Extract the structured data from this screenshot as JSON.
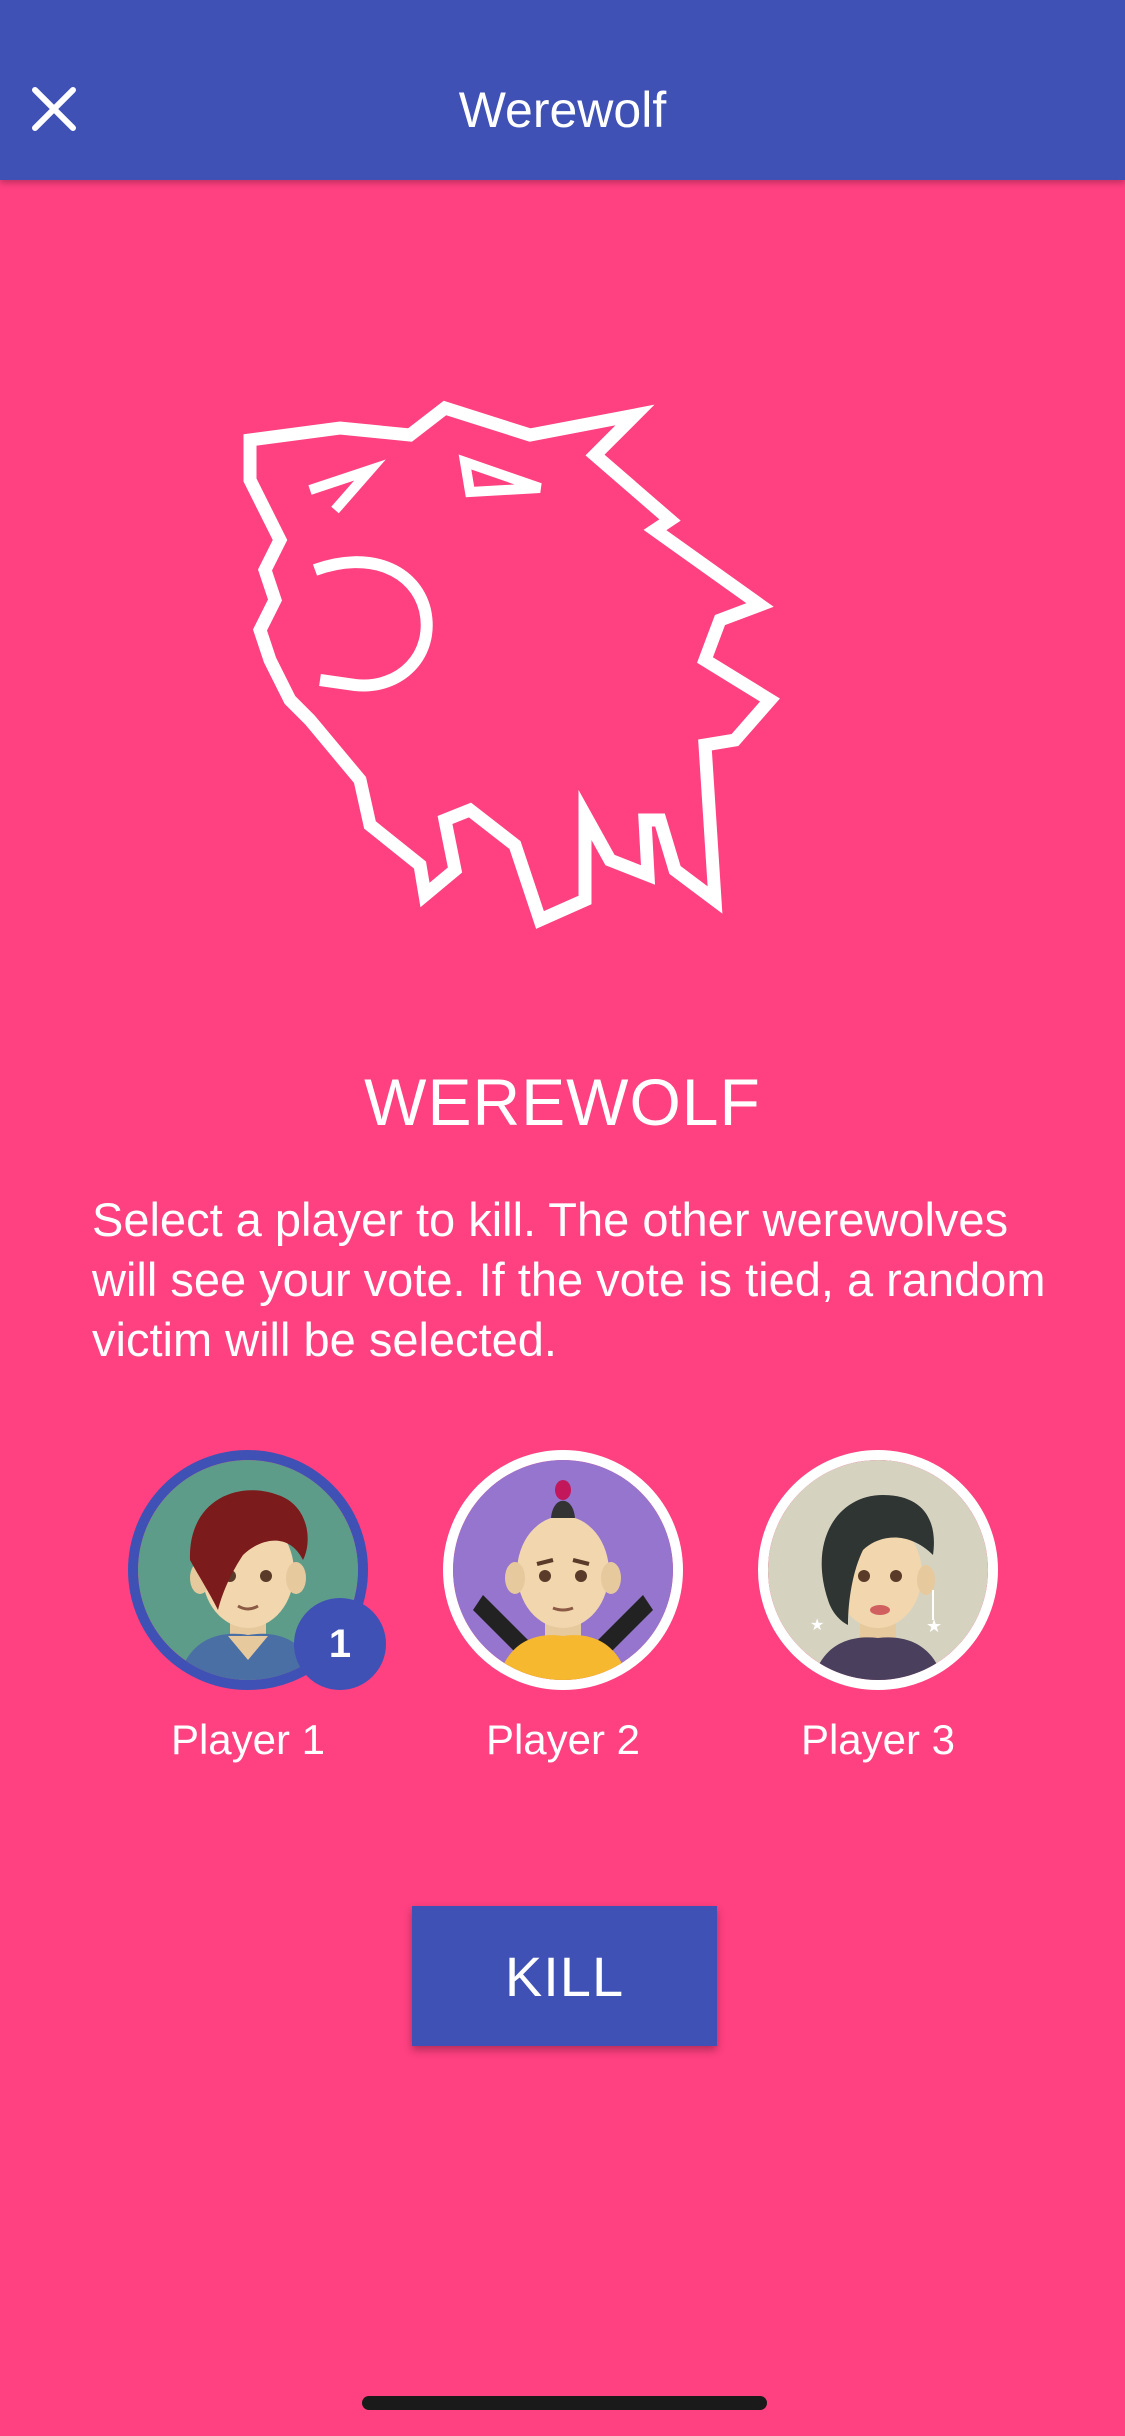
{
  "app_bar": {
    "title": "Werewolf",
    "close_icon": "close-icon",
    "color": "#3F51B5"
  },
  "role": {
    "icon": "werewolf-icon",
    "title": "WEREWOLF",
    "description": "Select a player to kill. The other werewolves will see your vote. If the vote is tied, a random victim will be selected."
  },
  "players": [
    {
      "name": "Player 1",
      "selected": true,
      "votes": "1",
      "avatar": "avatar-red-hair"
    },
    {
      "name": "Player 2",
      "selected": false,
      "avatar": "avatar-mohawk"
    },
    {
      "name": "Player 3",
      "selected": false,
      "avatar": "avatar-dark-hair"
    }
  ],
  "actions": {
    "kill_label": "KILL"
  },
  "colors": {
    "background": "#FF4081",
    "accent": "#3F51B5"
  }
}
